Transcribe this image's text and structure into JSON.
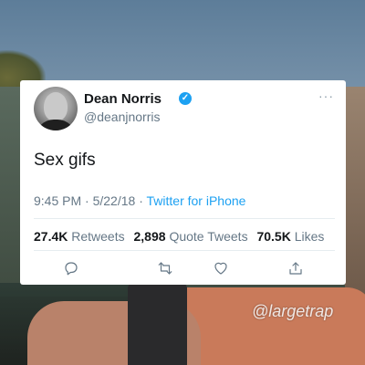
{
  "tweet": {
    "display_name": "Dean Norris",
    "handle": "@deanjnorris",
    "verified_icon": "verified-badge-icon",
    "more_icon": "more-horizontal-icon",
    "text": "Sex gifs",
    "time": "9:45 PM",
    "separator": "·",
    "date": "5/22/18",
    "source": "Twitter for iPhone",
    "stats": {
      "retweets_count": "27.4K",
      "retweets_label": "Retweets",
      "quote_count": "2,898",
      "quote_label": "Quote Tweets",
      "likes_count": "70.5K",
      "likes_label": "Likes"
    },
    "actions": [
      {
        "icon": "reply-icon"
      },
      {
        "icon": "retweet-icon"
      },
      {
        "icon": "like-heart-icon"
      },
      {
        "icon": "share-icon"
      }
    ],
    "colors": {
      "link_blue": "#1da1f2",
      "secondary_text": "#657786",
      "primary_text": "#14171a"
    }
  },
  "watermark": "@largetrap"
}
